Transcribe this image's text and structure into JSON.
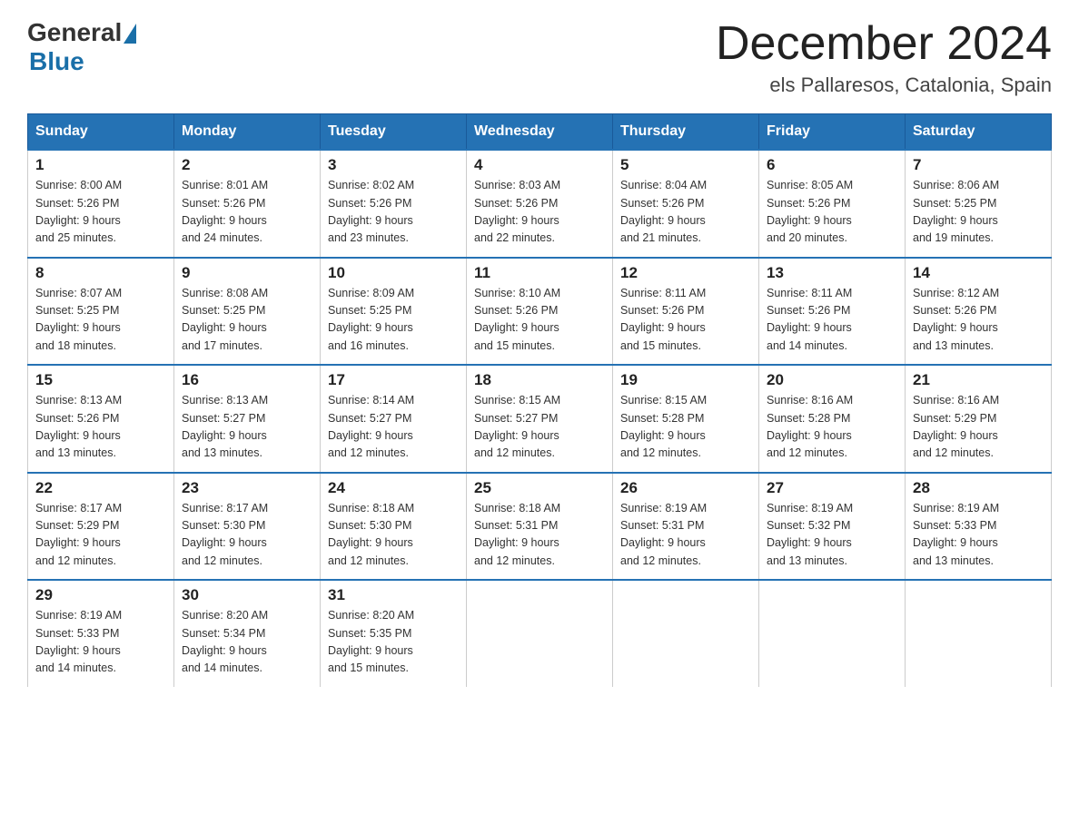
{
  "logo": {
    "general": "General",
    "blue": "Blue"
  },
  "title": "December 2024",
  "subtitle": "els Pallaresos, Catalonia, Spain",
  "days_of_week": [
    "Sunday",
    "Monday",
    "Tuesday",
    "Wednesday",
    "Thursday",
    "Friday",
    "Saturday"
  ],
  "weeks": [
    [
      {
        "day": "1",
        "sunrise": "8:00 AM",
        "sunset": "5:26 PM",
        "daylight": "9 hours and 25 minutes."
      },
      {
        "day": "2",
        "sunrise": "8:01 AM",
        "sunset": "5:26 PM",
        "daylight": "9 hours and 24 minutes."
      },
      {
        "day": "3",
        "sunrise": "8:02 AM",
        "sunset": "5:26 PM",
        "daylight": "9 hours and 23 minutes."
      },
      {
        "day": "4",
        "sunrise": "8:03 AM",
        "sunset": "5:26 PM",
        "daylight": "9 hours and 22 minutes."
      },
      {
        "day": "5",
        "sunrise": "8:04 AM",
        "sunset": "5:26 PM",
        "daylight": "9 hours and 21 minutes."
      },
      {
        "day": "6",
        "sunrise": "8:05 AM",
        "sunset": "5:26 PM",
        "daylight": "9 hours and 20 minutes."
      },
      {
        "day": "7",
        "sunrise": "8:06 AM",
        "sunset": "5:25 PM",
        "daylight": "9 hours and 19 minutes."
      }
    ],
    [
      {
        "day": "8",
        "sunrise": "8:07 AM",
        "sunset": "5:25 PM",
        "daylight": "9 hours and 18 minutes."
      },
      {
        "day": "9",
        "sunrise": "8:08 AM",
        "sunset": "5:25 PM",
        "daylight": "9 hours and 17 minutes."
      },
      {
        "day": "10",
        "sunrise": "8:09 AM",
        "sunset": "5:25 PM",
        "daylight": "9 hours and 16 minutes."
      },
      {
        "day": "11",
        "sunrise": "8:10 AM",
        "sunset": "5:26 PM",
        "daylight": "9 hours and 15 minutes."
      },
      {
        "day": "12",
        "sunrise": "8:11 AM",
        "sunset": "5:26 PM",
        "daylight": "9 hours and 15 minutes."
      },
      {
        "day": "13",
        "sunrise": "8:11 AM",
        "sunset": "5:26 PM",
        "daylight": "9 hours and 14 minutes."
      },
      {
        "day": "14",
        "sunrise": "8:12 AM",
        "sunset": "5:26 PM",
        "daylight": "9 hours and 13 minutes."
      }
    ],
    [
      {
        "day": "15",
        "sunrise": "8:13 AM",
        "sunset": "5:26 PM",
        "daylight": "9 hours and 13 minutes."
      },
      {
        "day": "16",
        "sunrise": "8:13 AM",
        "sunset": "5:27 PM",
        "daylight": "9 hours and 13 minutes."
      },
      {
        "day": "17",
        "sunrise": "8:14 AM",
        "sunset": "5:27 PM",
        "daylight": "9 hours and 12 minutes."
      },
      {
        "day": "18",
        "sunrise": "8:15 AM",
        "sunset": "5:27 PM",
        "daylight": "9 hours and 12 minutes."
      },
      {
        "day": "19",
        "sunrise": "8:15 AM",
        "sunset": "5:28 PM",
        "daylight": "9 hours and 12 minutes."
      },
      {
        "day": "20",
        "sunrise": "8:16 AM",
        "sunset": "5:28 PM",
        "daylight": "9 hours and 12 minutes."
      },
      {
        "day": "21",
        "sunrise": "8:16 AM",
        "sunset": "5:29 PM",
        "daylight": "9 hours and 12 minutes."
      }
    ],
    [
      {
        "day": "22",
        "sunrise": "8:17 AM",
        "sunset": "5:29 PM",
        "daylight": "9 hours and 12 minutes."
      },
      {
        "day": "23",
        "sunrise": "8:17 AM",
        "sunset": "5:30 PM",
        "daylight": "9 hours and 12 minutes."
      },
      {
        "day": "24",
        "sunrise": "8:18 AM",
        "sunset": "5:30 PM",
        "daylight": "9 hours and 12 minutes."
      },
      {
        "day": "25",
        "sunrise": "8:18 AM",
        "sunset": "5:31 PM",
        "daylight": "9 hours and 12 minutes."
      },
      {
        "day": "26",
        "sunrise": "8:19 AM",
        "sunset": "5:31 PM",
        "daylight": "9 hours and 12 minutes."
      },
      {
        "day": "27",
        "sunrise": "8:19 AM",
        "sunset": "5:32 PM",
        "daylight": "9 hours and 13 minutes."
      },
      {
        "day": "28",
        "sunrise": "8:19 AM",
        "sunset": "5:33 PM",
        "daylight": "9 hours and 13 minutes."
      }
    ],
    [
      {
        "day": "29",
        "sunrise": "8:19 AM",
        "sunset": "5:33 PM",
        "daylight": "9 hours and 14 minutes."
      },
      {
        "day": "30",
        "sunrise": "8:20 AM",
        "sunset": "5:34 PM",
        "daylight": "9 hours and 14 minutes."
      },
      {
        "day": "31",
        "sunrise": "8:20 AM",
        "sunset": "5:35 PM",
        "daylight": "9 hours and 15 minutes."
      },
      null,
      null,
      null,
      null
    ]
  ],
  "labels": {
    "sunrise": "Sunrise:",
    "sunset": "Sunset:",
    "daylight": "Daylight:"
  }
}
